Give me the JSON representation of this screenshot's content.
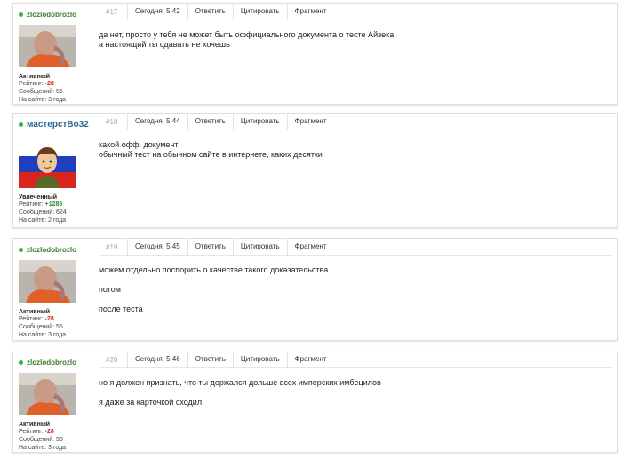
{
  "posts": [
    {
      "author": {
        "name": "zlozlodobrozlo",
        "status": "Активный",
        "rating_label": "Рейтинг:",
        "rating": "-28",
        "messages_label": "Сообщений:",
        "messages": "56",
        "onsite_label": "На сайте:",
        "onsite": "3 года"
      },
      "number": "#17",
      "time": "Сегодня, 5:42",
      "lines": [
        "да нет, просто у тебя не может быть оффициального документа о тесте Айзека",
        "а настоящий ты сдавать не хочешь"
      ]
    },
    {
      "author": {
        "name": "мастерстВо32",
        "status": "Увлеченный",
        "rating_label": "Рейтинг:",
        "rating": "+1285",
        "messages_label": "Сообщений:",
        "messages": "624",
        "onsite_label": "На сайте:",
        "onsite": "2 года"
      },
      "number": "#18",
      "time": "Сегодня, 5:44",
      "lines": [
        "какой офф. документ",
        "обычный тест на обычном сайте в интернете, каких десятки"
      ]
    },
    {
      "author": {
        "name": "zlozlodobrozlo",
        "status": "Активный",
        "rating_label": "Рейтинг:",
        "rating": "-28",
        "messages_label": "Сообщений:",
        "messages": "56",
        "onsite_label": "На сайте:",
        "onsite": "3 года"
      },
      "number": "#19",
      "time": "Сегодня, 5:45",
      "lines": [
        "можем отдельно поспорить о качестве такого доказательства",
        "потом",
        "после теста"
      ]
    },
    {
      "author": {
        "name": "zlozlodobrozlo",
        "status": "Активный",
        "rating_label": "Рейтинг:",
        "rating": "-28",
        "messages_label": "Сообщений:",
        "messages": "56",
        "onsite_label": "На сайте:",
        "onsite": "3 года"
      },
      "number": "#20",
      "time": "Сегодня, 5:46",
      "lines": [
        "но я должен признать, что ты держался дольше всех имперских имбецилов",
        "я даже за карточкой сходил"
      ]
    }
  ],
  "actions": {
    "reply": "Ответить",
    "quote": "Цитировать",
    "fragment": "Фрагмент"
  },
  "icons": {
    "online": "online-dot-icon"
  },
  "colors": {
    "online": "#3cb43c",
    "negative": "#cc2222",
    "positive": "#2a8a2a"
  }
}
